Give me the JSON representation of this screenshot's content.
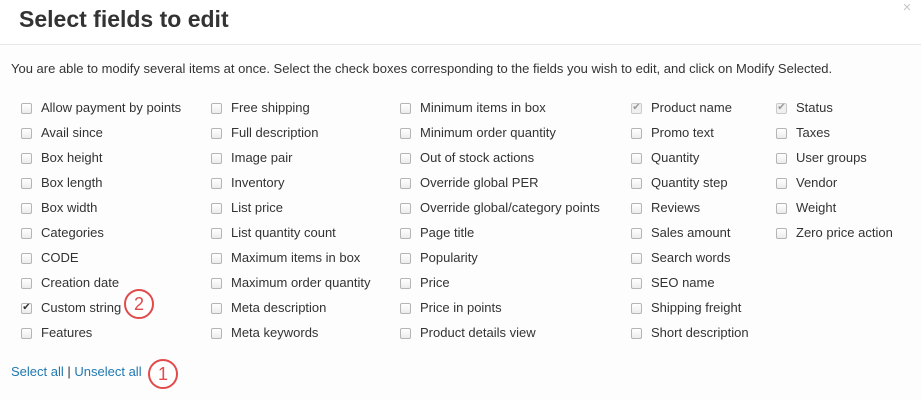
{
  "dialog": {
    "title": "Select fields to edit",
    "close_glyph": "×",
    "intro": "You are able to modify several items at once. Select the check boxes corresponding to the fields you wish to edit, and click on Modify Selected."
  },
  "columns": [
    [
      {
        "label": "Allow payment by points",
        "checked": false
      },
      {
        "label": "Avail since",
        "checked": false
      },
      {
        "label": "Box height",
        "checked": false
      },
      {
        "label": "Box length",
        "checked": false
      },
      {
        "label": "Box width",
        "checked": false
      },
      {
        "label": "Categories",
        "checked": false
      },
      {
        "label": "CODE",
        "checked": false
      },
      {
        "label": "Creation date",
        "checked": false
      },
      {
        "label": "Custom string",
        "checked": true
      },
      {
        "label": "Features",
        "checked": false
      }
    ],
    [
      {
        "label": "Free shipping",
        "checked": false
      },
      {
        "label": "Full description",
        "checked": false
      },
      {
        "label": "Image pair",
        "checked": false
      },
      {
        "label": "Inventory",
        "checked": false
      },
      {
        "label": "List price",
        "checked": false
      },
      {
        "label": "List quantity count",
        "checked": false
      },
      {
        "label": "Maximum items in box",
        "checked": false
      },
      {
        "label": "Maximum order quantity",
        "checked": false
      },
      {
        "label": "Meta description",
        "checked": false
      },
      {
        "label": "Meta keywords",
        "checked": false
      }
    ],
    [
      {
        "label": "Minimum items in box",
        "checked": false
      },
      {
        "label": "Minimum order quantity",
        "checked": false
      },
      {
        "label": "Out of stock actions",
        "checked": false
      },
      {
        "label": "Override global PER",
        "checked": false
      },
      {
        "label": "Override global/category points",
        "checked": false
      },
      {
        "label": "Page title",
        "checked": false
      },
      {
        "label": "Popularity",
        "checked": false
      },
      {
        "label": "Price",
        "checked": false
      },
      {
        "label": "Price in points",
        "checked": false
      },
      {
        "label": "Product details view",
        "checked": false
      }
    ],
    [
      {
        "label": "Product name",
        "checked": true,
        "disabled": true
      },
      {
        "label": "Promo text",
        "checked": false
      },
      {
        "label": "Quantity",
        "checked": false
      },
      {
        "label": "Quantity step",
        "checked": false
      },
      {
        "label": "Reviews",
        "checked": false
      },
      {
        "label": "Sales amount",
        "checked": false
      },
      {
        "label": "Search words",
        "checked": false
      },
      {
        "label": "SEO name",
        "checked": false
      },
      {
        "label": "Shipping freight",
        "checked": false
      },
      {
        "label": "Short description",
        "checked": false
      }
    ],
    [
      {
        "label": "Status",
        "checked": true,
        "disabled": true
      },
      {
        "label": "Taxes",
        "checked": false
      },
      {
        "label": "User groups",
        "checked": false
      },
      {
        "label": "Vendor",
        "checked": false
      },
      {
        "label": "Weight",
        "checked": false
      },
      {
        "label": "Zero price action",
        "checked": false
      }
    ]
  ],
  "links": {
    "select_all": "Select all",
    "separator": "|",
    "unselect_all": "Unselect all"
  },
  "annotations": [
    {
      "number": "2",
      "color": "#e14b4b"
    },
    {
      "number": "1",
      "color": "#e14b4b"
    }
  ],
  "colors": {
    "link": "#1f78b0",
    "annotation": "#e14b4b",
    "text": "#333333"
  }
}
